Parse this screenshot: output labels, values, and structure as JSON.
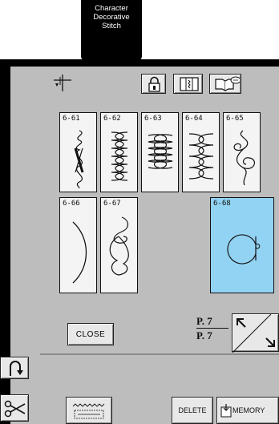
{
  "mode_tab": {
    "line1": "Character",
    "line2": "Decorative",
    "line3": "Stitch"
  },
  "toolbar": {
    "needle_icon": "needle-position-icon",
    "lock_icon": "lock-icon",
    "pattern_view_icon": "pattern-view-icon",
    "help_icon": "sewing-help-icon"
  },
  "stitches": [
    {
      "code": "6-61"
    },
    {
      "code": "6-62"
    },
    {
      "code": "6-63"
    },
    {
      "code": "6-64"
    },
    {
      "code": "6-65"
    },
    {
      "code": "6-66"
    },
    {
      "code": "6-67"
    },
    {
      "code": "6-68",
      "selected": true
    }
  ],
  "close_label": "CLOSE",
  "page": {
    "current": "P. 7",
    "total": "P. 7"
  },
  "bottom": {
    "delete_label": "DELETE",
    "memory_label": "MEMORY"
  },
  "colors": {
    "screen": "#bdbdbd",
    "selected_cell": "#92d3f3",
    "frame": "#000000"
  }
}
